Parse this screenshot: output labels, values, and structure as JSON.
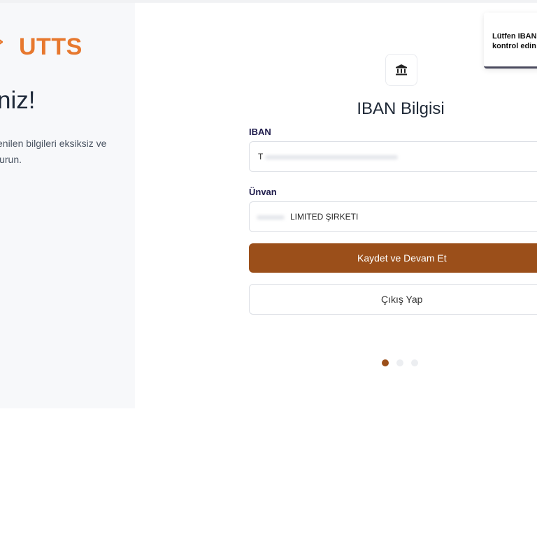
{
  "brand": {
    "name": "UTTS",
    "color": "#e7782e"
  },
  "left": {
    "welcome": "niz!",
    "description_line1": "enilen bilgileri eksiksiz ve",
    "description_line2": "lurun."
  },
  "form": {
    "icon": "bank-icon",
    "title": "IBAN Bilgisi",
    "iban_label": "IBAN",
    "iban_value": "T",
    "unvan_label": "Ünvan",
    "unvan_value": "LIMITED ŞIRKETI",
    "save_button": "Kaydet ve Devam Et",
    "logout_button": "Çıkış Yap",
    "accent_color": "#9b4f1a"
  },
  "steps": {
    "total": 3,
    "current": 1
  },
  "toast": {
    "line1": "Lütfen IBAN",
    "line2": "kontrol edin"
  }
}
